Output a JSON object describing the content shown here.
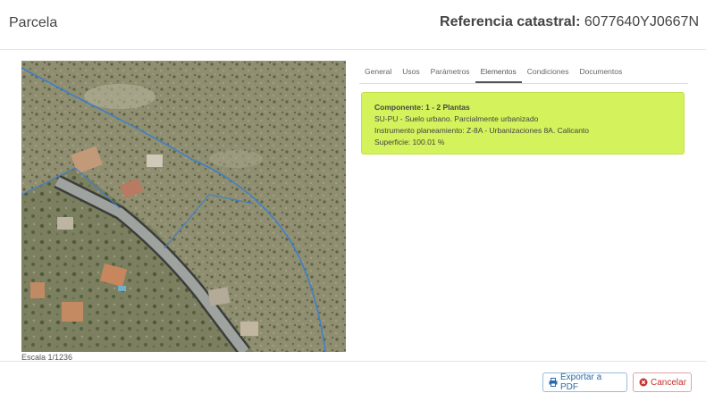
{
  "header": {
    "title": "Parcela",
    "ref_label": "Referencia catastral:",
    "ref_value": "6077640YJ0667N"
  },
  "map": {
    "scale": "Escala 1/1236"
  },
  "tabs": [
    {
      "label": "General"
    },
    {
      "label": "Usos"
    },
    {
      "label": "Parámetros"
    },
    {
      "label": "Elementos",
      "active": true
    },
    {
      "label": "Condiciones"
    },
    {
      "label": "Documentos"
    }
  ],
  "component": {
    "title": "Componente: 1 - 2 Plantas",
    "line1": "SU-PU - Suelo urbano. Parcialmente urbanizado",
    "line2": "Instrumento planeamiento: Z-8A - Urbanizaciones 8A. Calicanto",
    "line3": "Superficie: 100.01 %",
    "color": "#d4f25c"
  },
  "footer": {
    "pdf_label": "Exportar a PDF",
    "pdf_icon": "print-icon",
    "cancel_label": "Cancelar",
    "cancel_icon": "times-circle-icon"
  }
}
